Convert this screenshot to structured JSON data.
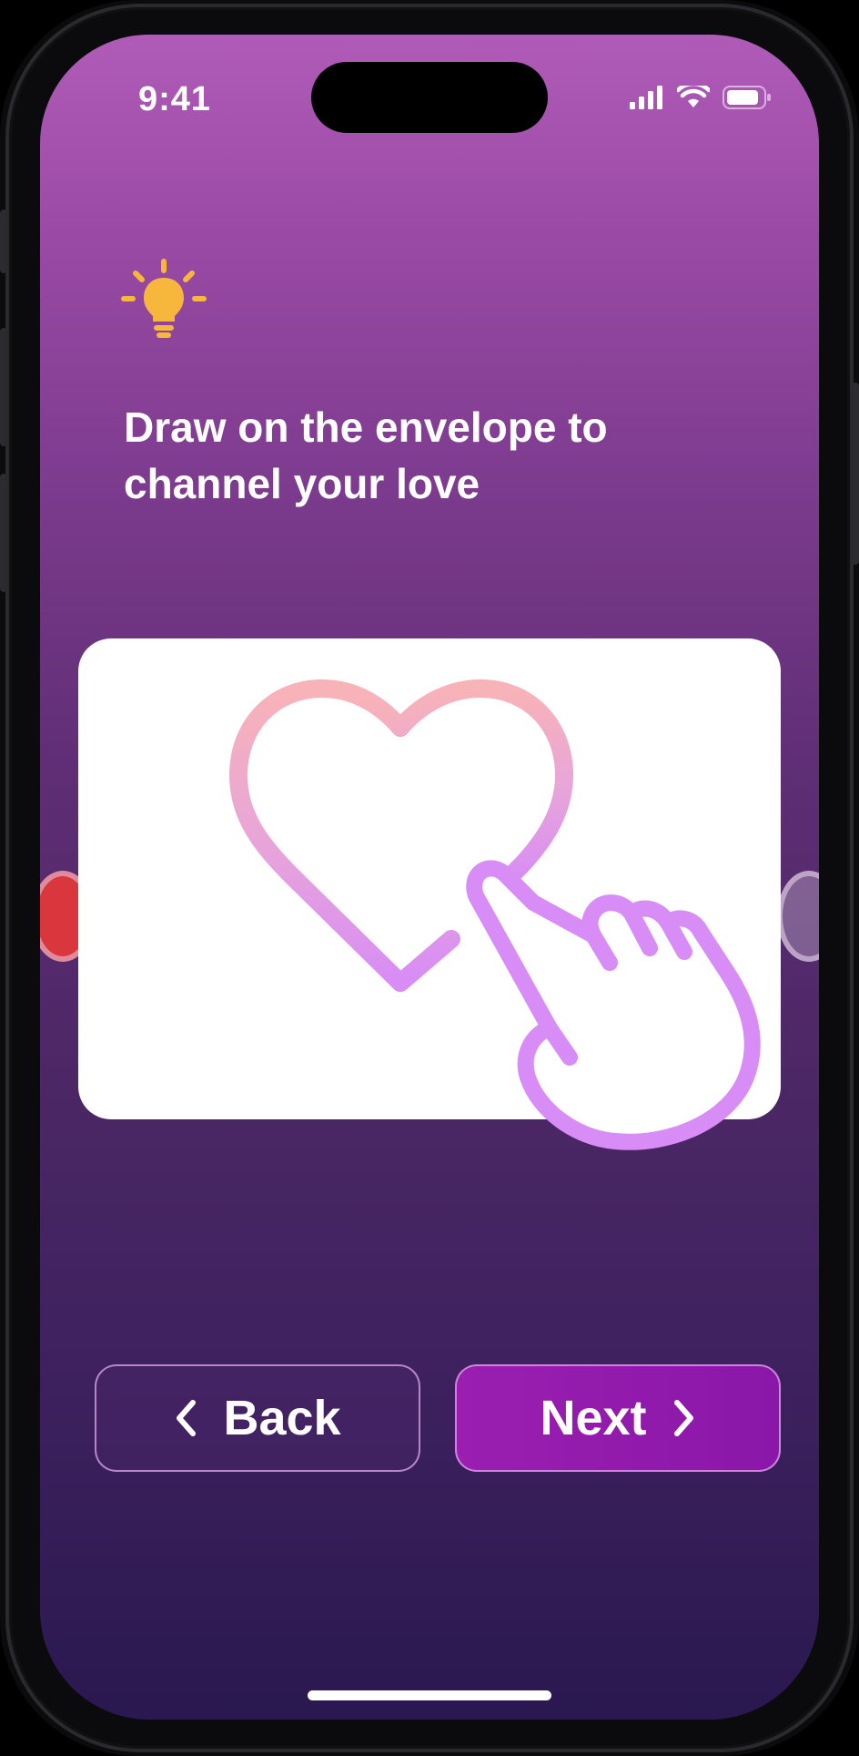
{
  "status_bar": {
    "time": "9:41",
    "icons": [
      "cellular-signal-icon",
      "wifi-icon",
      "battery-icon"
    ]
  },
  "tip": {
    "icon": "lightbulb-icon",
    "headline_line1": "Draw on the envelope to",
    "headline_line2": "channel your love"
  },
  "envelope": {
    "illustration": [
      "heart-outline-icon",
      "pointing-hand-icon"
    ]
  },
  "carousel": {
    "active_color": "#d9363e"
  },
  "nav": {
    "back_label": "Back",
    "next_label": "Next"
  },
  "colors": {
    "accent": "#8a17a8",
    "bulb": "#f6b73c",
    "heart_top": "#f8b3b8",
    "heart_bottom": "#d88cf5"
  }
}
